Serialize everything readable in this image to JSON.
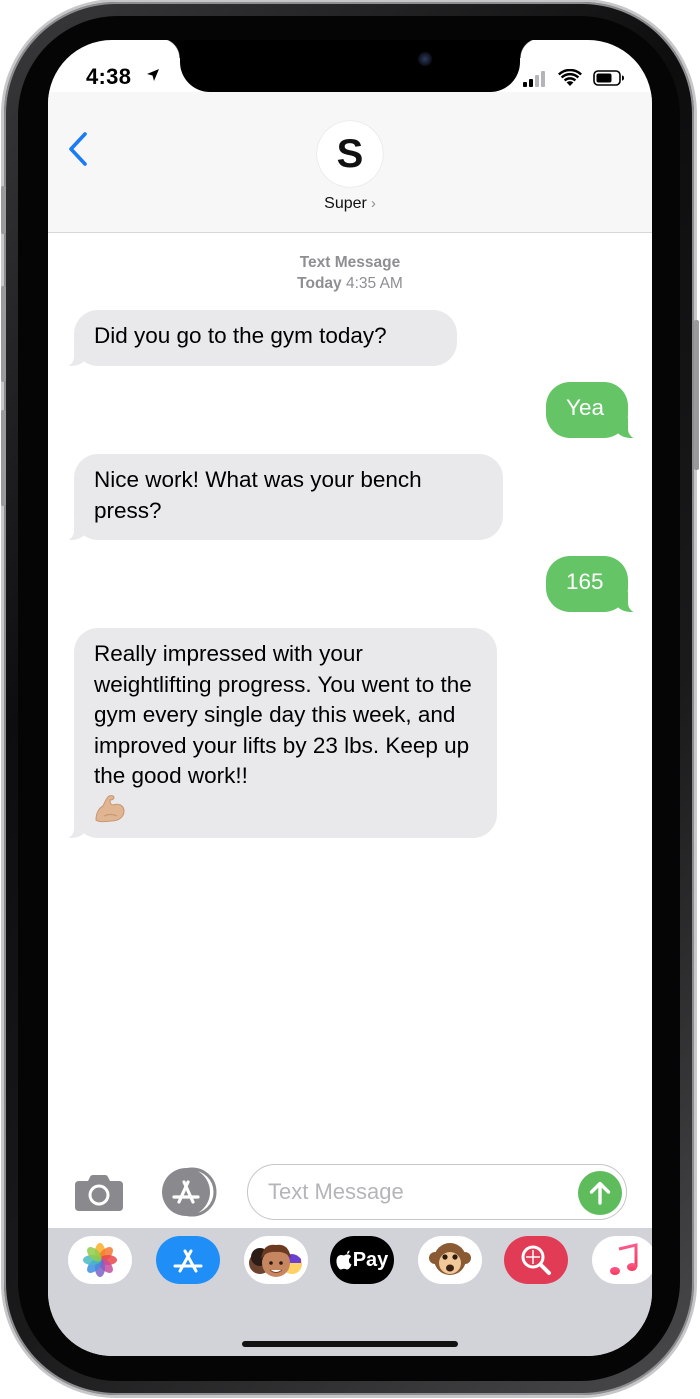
{
  "status_bar": {
    "time": "4:38"
  },
  "header": {
    "avatar_initial": "S",
    "contact_name": "Super",
    "chevron": "›"
  },
  "thread": {
    "stamp_label": "Text Message",
    "stamp_day": "Today",
    "stamp_time": "4:35 AM",
    "messages": [
      {
        "direction": "received",
        "text": "Did you go to the gym today?"
      },
      {
        "direction": "sent",
        "text": "Yea"
      },
      {
        "direction": "received",
        "text": "Nice work! What was your bench press?"
      },
      {
        "direction": "sent",
        "text": "165"
      },
      {
        "direction": "received",
        "text": "Really impressed with your weightlifting progress. You went to the gym every single day this week, and improved your lifts by 23 lbs. Keep up the good work!!",
        "emoji": "flexed-biceps-icon"
      }
    ]
  },
  "composer": {
    "placeholder": "Text Message",
    "value": ""
  },
  "apps": [
    {
      "name": "photos-icon",
      "color": "#ffffff"
    },
    {
      "name": "app-store-icon",
      "color": "#1f8ff7"
    },
    {
      "name": "memoji-icon",
      "color": "#ffffff"
    },
    {
      "name": "apple-pay-icon",
      "color": "#000000",
      "label": "Pay"
    },
    {
      "name": "animoji-monkey-icon",
      "color": "#ffffff"
    },
    {
      "name": "images-search-icon",
      "color": "#e23b55"
    },
    {
      "name": "music-icon",
      "color": "#ffffff"
    }
  ],
  "colors": {
    "sent_bubble": "#65c466",
    "received_bubble": "#e9e9eb",
    "accent": "#1a7cf5"
  }
}
